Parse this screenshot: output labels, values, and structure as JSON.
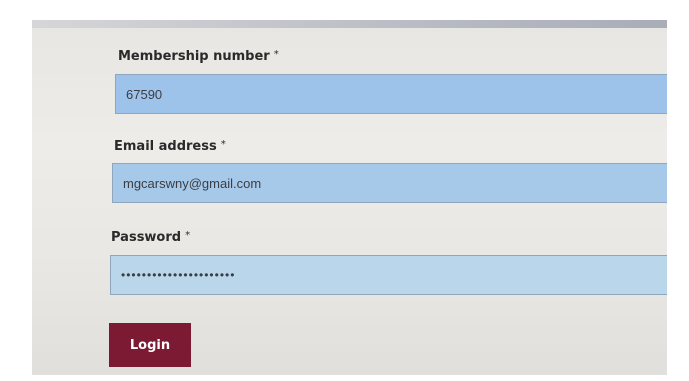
{
  "form": {
    "membership": {
      "label": "Membership number",
      "required_mark": "*",
      "value": "67590"
    },
    "email": {
      "label": "Email address",
      "required_mark": "*",
      "value": "mgcarswny@gmail.com"
    },
    "password": {
      "label": "Password",
      "required_mark": "*",
      "value": "••••••••••••••••••••••"
    },
    "login_label": "Login"
  },
  "colors": {
    "button_background": "#7c1a33",
    "input_background": "#9ec3eb"
  }
}
